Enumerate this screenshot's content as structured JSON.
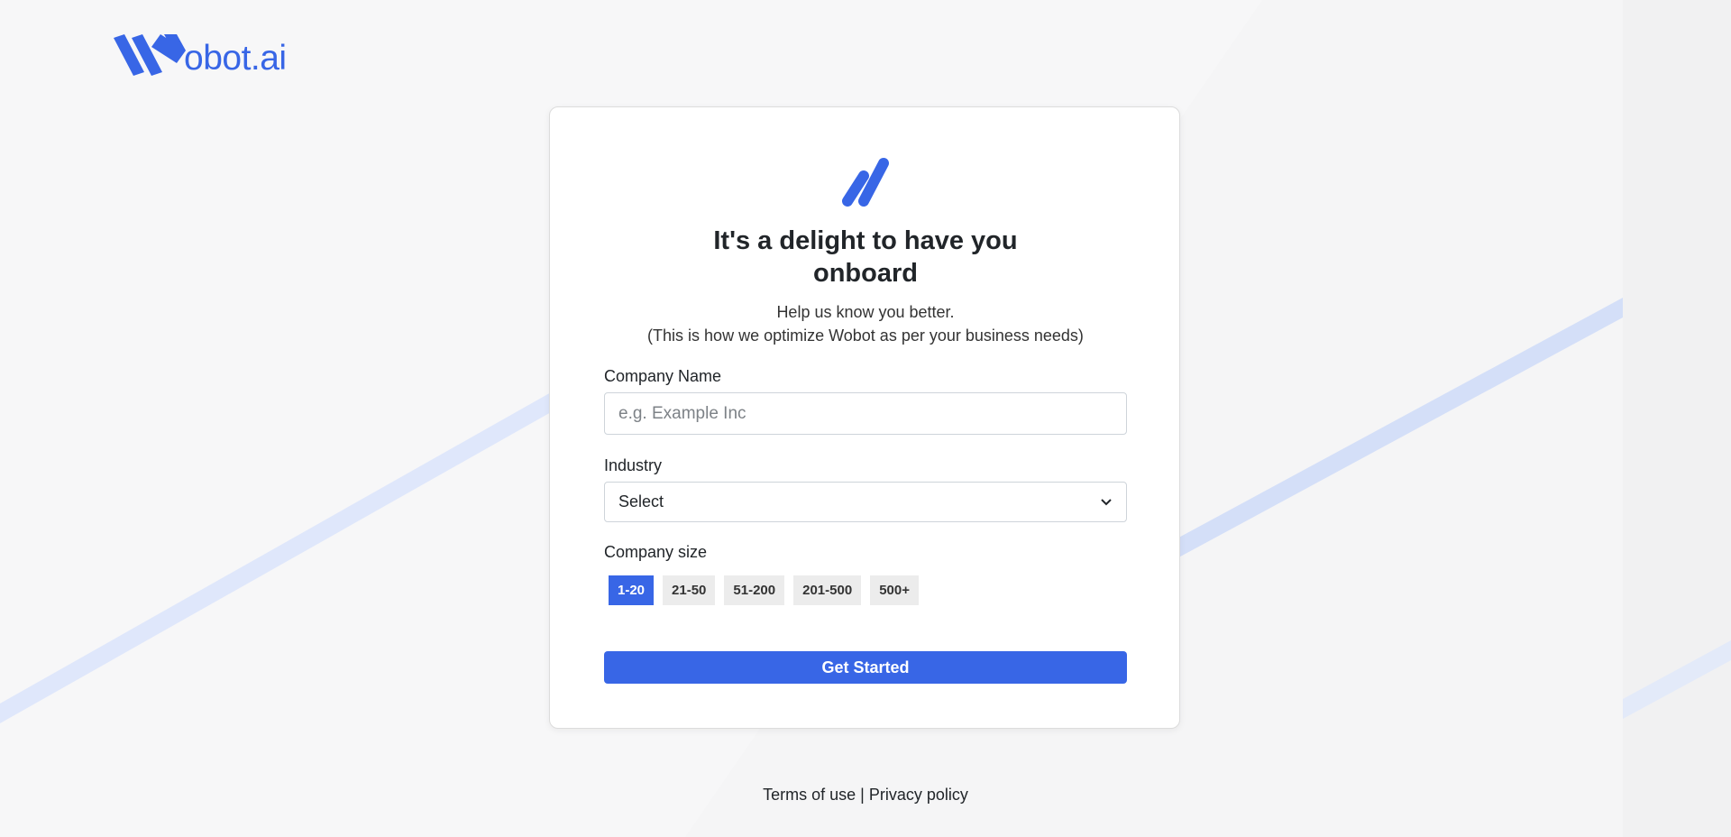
{
  "brand": {
    "name": "obot.ai",
    "accent": "#3866e6"
  },
  "card": {
    "title_line1": "It's a delight to have you",
    "title_line2": "onboard",
    "subtitle_line1": "Help us know you better.",
    "subtitle_line2": "(This is how we optimize Wobot as per your business needs)"
  },
  "form": {
    "company_name_label": "Company Name",
    "company_name_placeholder": "e.g. Example Inc",
    "industry_label": "Industry",
    "industry_value": "Select",
    "company_size_label": "Company size",
    "sizes": [
      "1-20",
      "21-50",
      "51-200",
      "201-500",
      "500+"
    ],
    "selected_size": "1-20",
    "submit_label": "Get Started"
  },
  "footer": {
    "terms": "Terms of use",
    "separator": "|",
    "privacy": "Privacy policy"
  }
}
